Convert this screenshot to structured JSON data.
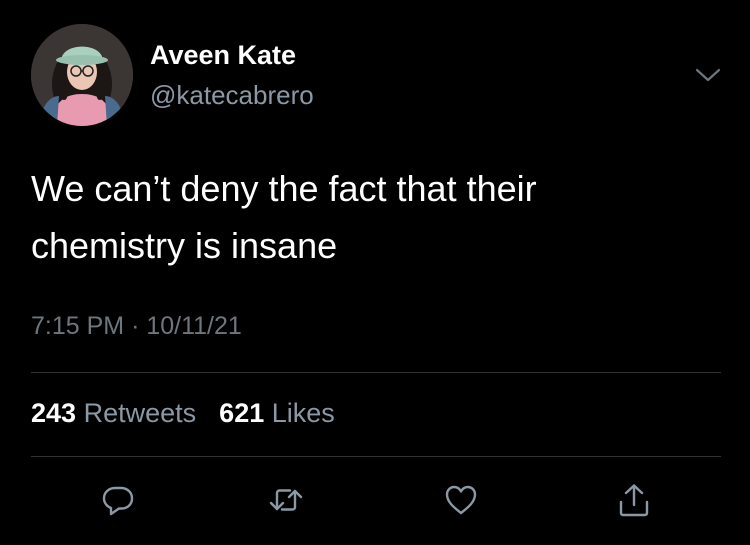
{
  "author": {
    "display_name": "Aveen Kate",
    "handle": "@katecabrero",
    "avatar_icon": "profile-photo"
  },
  "tweet": {
    "text_lines": [
      "We can’t deny the fact that their",
      "chemistry is insane"
    ],
    "time": "7:15 PM",
    "separator": "·",
    "date": "10/11/21"
  },
  "stats": {
    "retweets_count": "243",
    "retweets_label": "Retweets",
    "likes_count": "621",
    "likes_label": "Likes"
  },
  "actions": {
    "reply_icon": "reply-icon",
    "retweet_icon": "retweet-icon",
    "like_icon": "heart-icon",
    "share_icon": "share-icon"
  },
  "colors": {
    "background": "#000000",
    "primary_text": "#ffffff",
    "secondary_text": "#8b98a5",
    "divider": "#2f3336"
  }
}
